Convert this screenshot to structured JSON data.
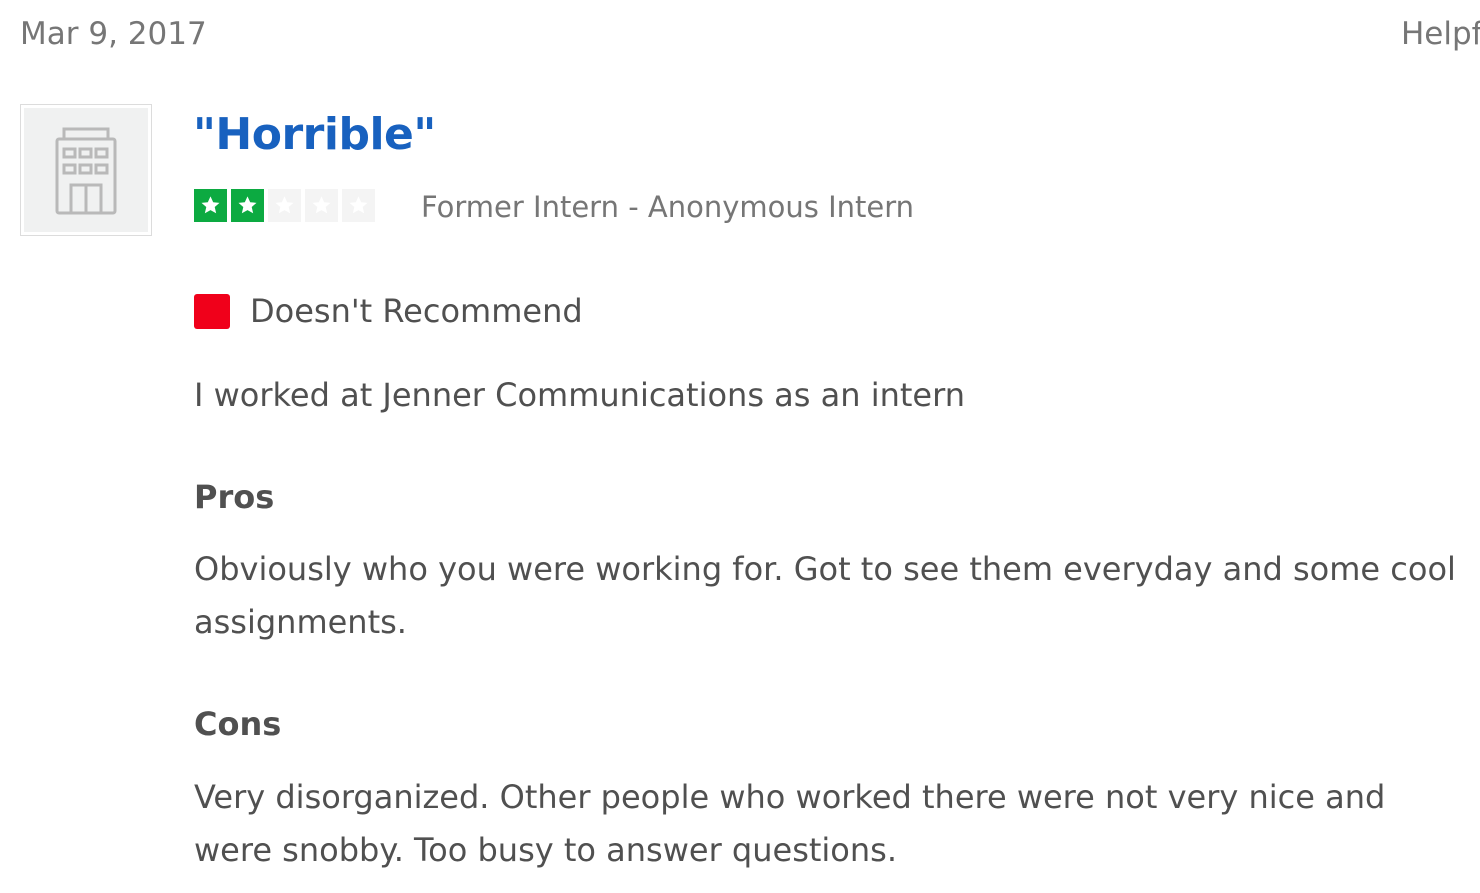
{
  "review": {
    "date": "Mar 9, 2017",
    "helpful_label": "Helpf",
    "logo_icon": "building-icon",
    "title": "\"Horrible\"",
    "rating": {
      "value": 2,
      "max": 5,
      "on_color": "#0caa41",
      "off_color": "#f4f4f4"
    },
    "author": "Former Intern - Anonymous Intern",
    "recommendation": {
      "label": "Doesn't Recommend",
      "color": "#f0001a"
    },
    "employment": "I worked at Jenner Communications as an intern",
    "pros": {
      "heading": "Pros",
      "text": "Obviously who you were working for. Got to see them everyday and some cool assignments."
    },
    "cons": {
      "heading": "Cons",
      "text": "Very disorganized. Other people who worked there were not very nice and were snobby. Too busy to answer questions."
    }
  }
}
